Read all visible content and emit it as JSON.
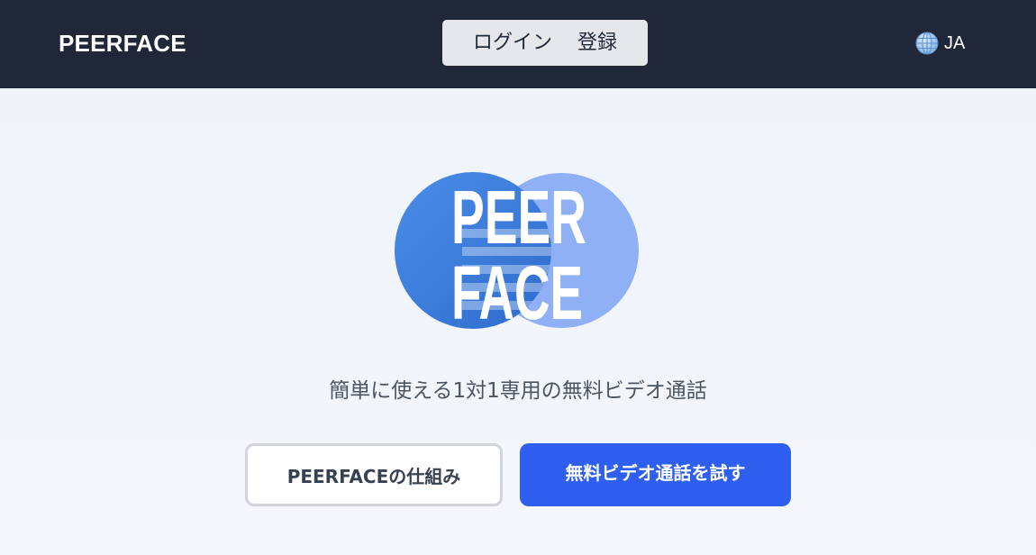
{
  "header": {
    "brand": "PEERFACE",
    "login_label": "ログイン",
    "register_label": "登録",
    "language_label": "JA",
    "language_icon": "globe-icon"
  },
  "logo": {
    "line1": "PEER",
    "line2": "FACE",
    "colors": {
      "left_circle": "#3b7bde",
      "right_circle": "#8fb0f5"
    }
  },
  "hero": {
    "tagline": "簡単に使える1対1専用の無料ビデオ通話",
    "secondary_button": "PEERFACEの仕組み",
    "primary_button": "無料ビデオ通話を試す"
  },
  "colors": {
    "navbar_bg": "#1f2738",
    "primary": "#2f5ff0",
    "page_bg": "#eef3fb"
  }
}
